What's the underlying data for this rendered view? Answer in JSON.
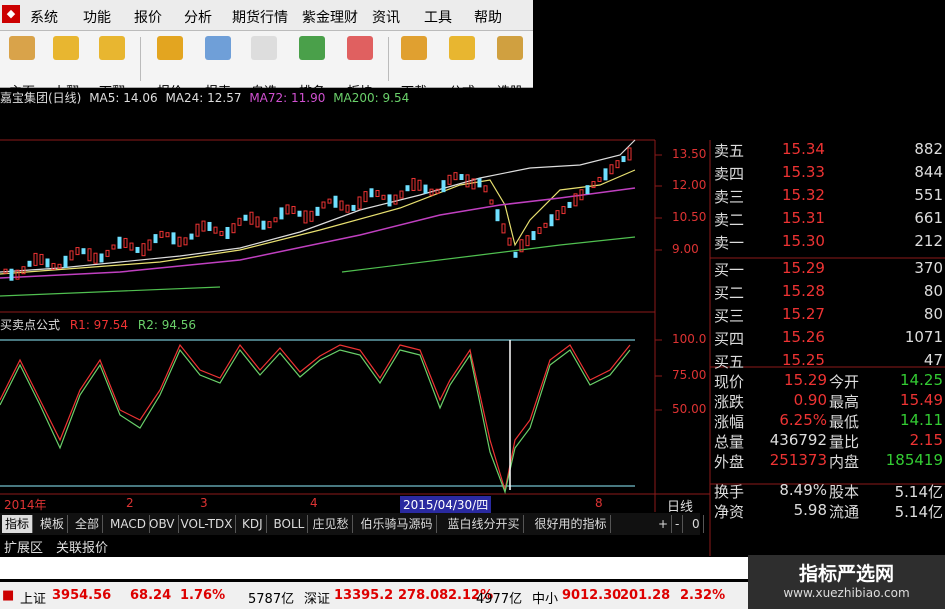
{
  "menu": [
    "系统",
    "功能",
    "报价",
    "分析",
    "期货行情",
    "紫金理财",
    "资讯",
    "工具",
    "帮助"
  ],
  "toolbar": [
    {
      "label": "主页",
      "icon": "home-icon",
      "color": "#d9a34a"
    },
    {
      "label": "上翻",
      "icon": "up-arrow-icon",
      "color": "#e8b630"
    },
    {
      "label": "下翻",
      "icon": "down-arrow-icon",
      "color": "#e8b630"
    },
    {
      "label": "报价",
      "icon": "yen-icon",
      "color": "#e3a520"
    },
    {
      "label": "报表",
      "icon": "report-icon",
      "color": "#6f9fd8"
    },
    {
      "label": "自选",
      "icon": "f6-icon",
      "color": "#dddddd"
    },
    {
      "label": "排名",
      "icon": "rank-icon",
      "color": "#4aa04a"
    },
    {
      "label": "板块",
      "icon": "blocks-icon",
      "color": "#e06060"
    },
    {
      "label": "下载",
      "icon": "download-icon",
      "color": "#e0a030"
    },
    {
      "label": "公式",
      "icon": "formula-icon",
      "color": "#e8b630"
    },
    {
      "label": "选股",
      "icon": "select-stock-icon",
      "color": "#d0a040"
    }
  ],
  "ma": {
    "title": "嘉宝集团(日线)",
    "ma5": "MA5: 14.06",
    "ma24": "MA24: 12.57",
    "ma72": "MA72: 11.90",
    "ma200": "MA200: 9.54"
  },
  "indicator": {
    "name": "买卖点公式",
    "r1": "R1: 97.54",
    "r2": "R2: 94.56"
  },
  "price_axis": [
    "13.50",
    "12.00",
    "10.50",
    "9.00"
  ],
  "ind_axis": [
    "100.0",
    "75.00",
    "50.00"
  ],
  "date_axis": {
    "year": "2014年",
    "m2": "2",
    "m3": "3",
    "m4": "4",
    "highlight": "2015/04/30/四",
    "m8": "8",
    "period": "日线"
  },
  "order_book": [
    {
      "label": "卖五",
      "price": "15.34",
      "vol": "882"
    },
    {
      "label": "卖四",
      "price": "15.33",
      "vol": "844"
    },
    {
      "label": "卖三",
      "price": "15.32",
      "vol": "551"
    },
    {
      "label": "卖二",
      "price": "15.31",
      "vol": "661"
    },
    {
      "label": "卖一",
      "price": "15.30",
      "vol": "212"
    },
    {
      "label": "买一",
      "price": "15.29",
      "vol": "370"
    },
    {
      "label": "买二",
      "price": "15.28",
      "vol": "80"
    },
    {
      "label": "买三",
      "price": "15.27",
      "vol": "80"
    },
    {
      "label": "买四",
      "price": "15.26",
      "vol": "1071"
    },
    {
      "label": "买五",
      "price": "15.25",
      "vol": "47"
    }
  ],
  "stats": [
    {
      "l1": "现价",
      "v1": "15.29",
      "l2": "今开",
      "v2": "14.25",
      "c1": "#e33",
      "c2": "#3c3"
    },
    {
      "l1": "涨跌",
      "v1": "0.90",
      "l2": "最高",
      "v2": "15.49",
      "c1": "#e33",
      "c2": "#e33"
    },
    {
      "l1": "涨幅",
      "v1": "6.25%",
      "l2": "最低",
      "v2": "14.11",
      "c1": "#e33",
      "c2": "#3c3"
    },
    {
      "l1": "总量",
      "v1": "436792",
      "l2": "量比",
      "v2": "2.15",
      "c1": "#ddd",
      "c2": "#e33"
    },
    {
      "l1": "外盘",
      "v1": "251373",
      "l2": "内盘",
      "v2": "185419",
      "c1": "#e33",
      "c2": "#3c3"
    },
    {
      "l1": "换手",
      "v1": "8.49%",
      "l2": "股本",
      "v2": "5.14亿",
      "c1": "#ddd",
      "c2": "#ddd"
    },
    {
      "l1": "净资",
      "v1": "5.98",
      "l2": "流通",
      "v2": "5.14亿",
      "c1": "#ddd",
      "c2": "#ddd"
    }
  ],
  "tabs": [
    "指标",
    "模板",
    "全部",
    "MACD",
    "OBV",
    "VOL-TDX",
    "KDJ",
    "BOLL",
    "庄见愁",
    "伯乐骑马源码",
    "蓝白线分开买",
    "很好用的指标"
  ],
  "tab_controls": [
    "+",
    "-",
    "0"
  ],
  "row2": [
    "扩展区",
    "关联报价"
  ],
  "ticker": {
    "sh_name": "上证",
    "sh_val": "3954.56",
    "sh_chg": "68.24",
    "sh_pct": "1.76%",
    "sh_amt": "5787亿",
    "sz_name": "深证",
    "sz_val": "13395.2",
    "sz_chg": "278.08",
    "sz_pct": "2.12%",
    "sz_amt": "4977亿",
    "zx_name": "中小",
    "zx_val": "9012.30",
    "zx_chg": "201.28",
    "zx_pct": "2.32%"
  },
  "watermark": {
    "title": "指标严选网",
    "url": "www.xuezhibiao.com"
  }
}
